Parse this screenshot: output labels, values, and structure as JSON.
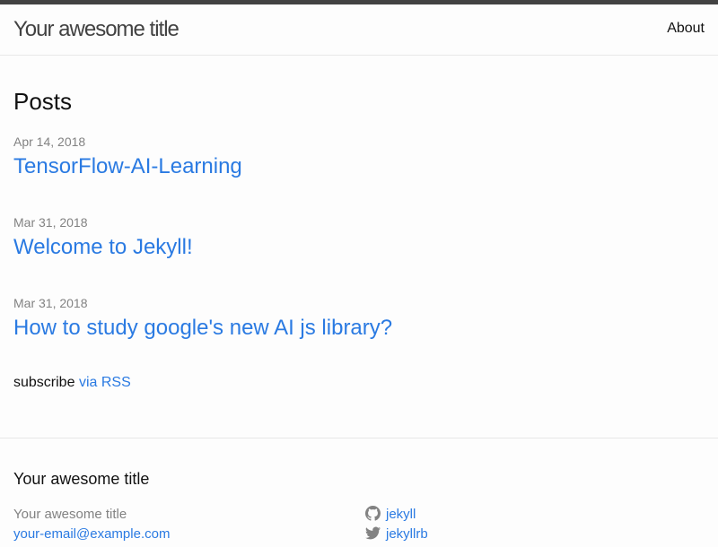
{
  "header": {
    "site_title": "Your awesome title",
    "nav": [
      {
        "label": "About"
      }
    ]
  },
  "main": {
    "heading": "Posts",
    "posts": [
      {
        "date": "Apr 14, 2018",
        "title": "TensorFlow-AI-Learning"
      },
      {
        "date": "Mar 31, 2018",
        "title": "Welcome to Jekyll!"
      },
      {
        "date": "Mar 31, 2018",
        "title": "How to study google's new AI js library?"
      }
    ],
    "subscribe_text": "subscribe",
    "rss_link": "via RSS"
  },
  "footer": {
    "heading": "Your awesome title",
    "name": "Your awesome title",
    "email": "your-email@example.com",
    "social": [
      {
        "icon": "github-icon",
        "label": "jekyll"
      },
      {
        "icon": "twitter-icon",
        "label": "jekyllrb"
      }
    ]
  },
  "colors": {
    "link": "#2a7ae2",
    "meta": "#828282",
    "top_bar": "#424242",
    "border": "#e8e8e8",
    "background": "#fdfdfd"
  }
}
